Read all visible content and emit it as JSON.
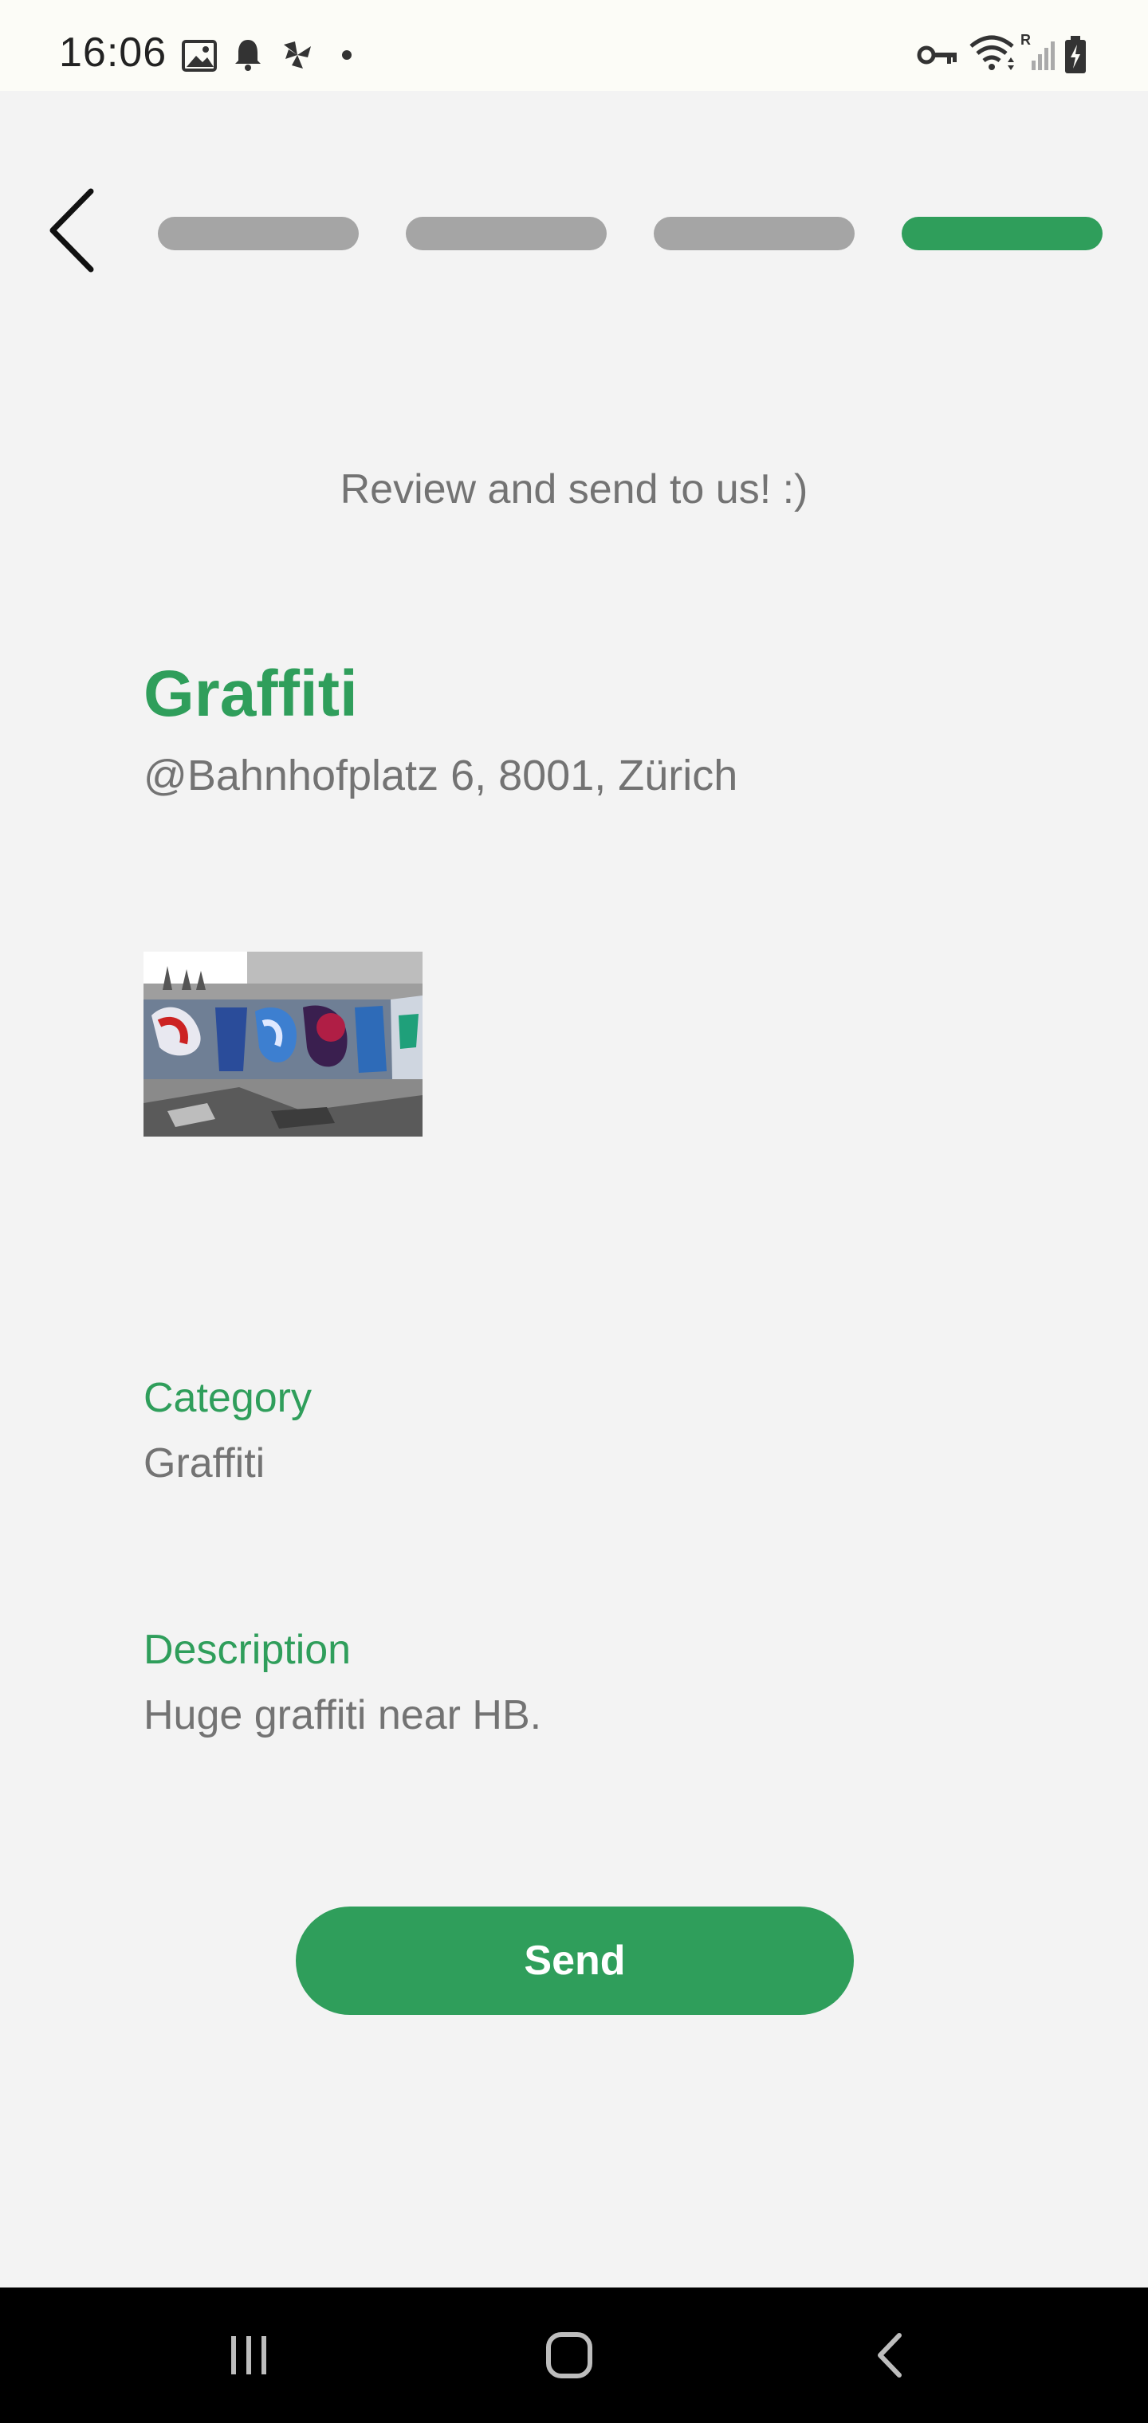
{
  "status_bar": {
    "time": "16:06",
    "left_icons": [
      "image-icon",
      "bell-icon",
      "pinwheel-icon",
      "dot-icon"
    ],
    "right_icons": [
      "key-icon",
      "wifi-icon",
      "signal-icon",
      "battery-icon"
    ]
  },
  "progress": {
    "steps": 4,
    "current_step": 4,
    "active_color": "#2f9e5b",
    "inactive_color": "#a5a5a5"
  },
  "header": {
    "subtitle": "Review and send to us! :)"
  },
  "report": {
    "title": "Graffiti",
    "address": "@Bahnhofplatz 6, 8001, Zürich",
    "category_label": "Category",
    "category_value": "Graffiti",
    "description_label": "Description",
    "description_value": "Huge graffiti near HB."
  },
  "actions": {
    "send_label": "Send"
  },
  "colors": {
    "accent": "#2f9e5b",
    "text_muted": "#737373",
    "background": "#f3f3f3"
  }
}
